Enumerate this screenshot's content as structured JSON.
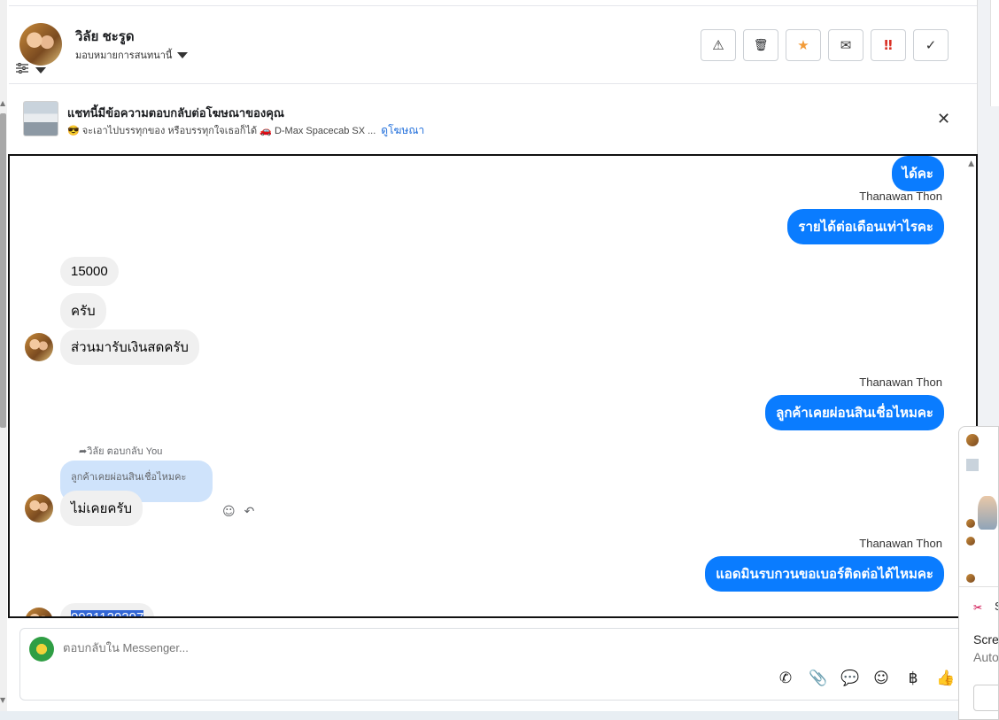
{
  "header": {
    "contact_name": "วิลัย ชะรูด",
    "assign_label": "มอบหมายการสนทนานี้"
  },
  "actions": [
    {
      "name": "report-button",
      "icon": "warning-icon",
      "glyph": "⚠"
    },
    {
      "name": "delete-button",
      "icon": "trash-icon",
      "glyph": "🗑"
    },
    {
      "name": "star-button",
      "icon": "star-icon",
      "glyph": "★"
    },
    {
      "name": "mark-unread-button",
      "icon": "envelope-open-icon",
      "glyph": "✉"
    },
    {
      "name": "priority-button",
      "icon": "double-exclamation-icon",
      "glyph": "‼"
    },
    {
      "name": "done-button",
      "icon": "checkmark-icon",
      "glyph": "✓"
    }
  ],
  "ad_banner": {
    "title": "แชทนี้มีข้อความตอบกลับต่อโฆษณาของคุณ",
    "subtitle": "😎 จะเอาไปบรรทุกของ หรือบรรทุกใจเธอก็ได้ 🚗 D-Max Spacecab SX ...",
    "link": "ดูโฆษณา"
  },
  "messages": {
    "m1": "ได้คะ",
    "sender1": "Thanawan Thon",
    "m2": "รายได้ต่อเดือนเท่าไรคะ",
    "m3": "15000",
    "m4": "ครับ",
    "m5": "ส่วนมารับเงินสดครับ",
    "sender2": "Thanawan Thon",
    "m6": "ลูกค้าเคยผ่อนสินเชื่อไหมคะ",
    "reply_meta": "วิลัย ตอบกลับ You",
    "quoted": "ลูกค้าเคยผ่อนสินเชื่อไหมคะ",
    "m7": "ไม่เคยครับ",
    "sender3": "Thanawan Thon",
    "m8": "แอดมินรบกวนขอเบอร์ติดต่อได้ไหมคะ",
    "m9_partial": "0921129297"
  },
  "composer": {
    "placeholder": "ตอบกลับใน Messenger..."
  },
  "popup": {
    "s_label": "S",
    "line1": "Scree",
    "line2": "Auto"
  },
  "colors": {
    "outgoing_bubble": "#0a7cff",
    "incoming_bubble": "#f0f0f0",
    "quoted_bubble": "#cfe3fb",
    "link": "#216fdb",
    "star": "#f29b38",
    "priority": "#d93025"
  }
}
